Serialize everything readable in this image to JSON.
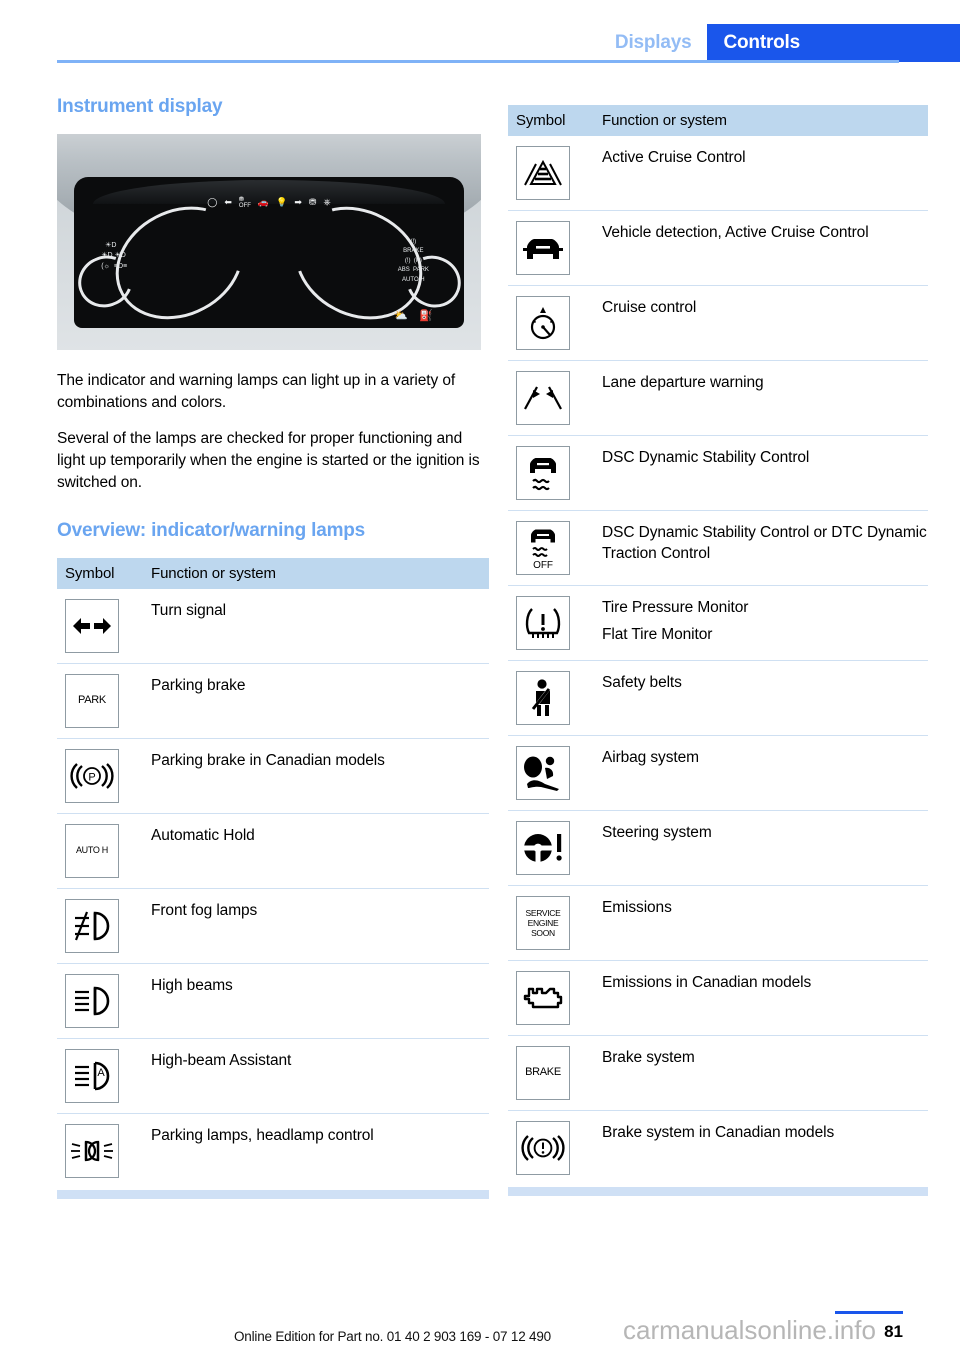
{
  "header": {
    "tab_inactive": "Displays",
    "tab_active": "Controls",
    "accent_blue": "#1A56EB",
    "light_blue": "#93bcf5"
  },
  "left": {
    "section_title": "Instrument display",
    "paragraphs": [
      "The indicator and warning lamps can light up in a variety of combinations and colors.",
      "Several of the lamps are checked for proper functioning and light up temporarily when the engine is started or the ignition is switched on."
    ],
    "overview_title": "Overview: indicator/warning lamps",
    "cluster": {
      "left_indicators": [
        "fog-lamp-icon",
        "low-beam-icon",
        "high-beam-icon",
        "parking-lamp-icon",
        "headlamp-icon"
      ],
      "right_indicators": [
        "BRAKE",
        "ABS",
        "PARK",
        "AUTO H"
      ],
      "bottom_right": "7\\  ☵"
    },
    "table": {
      "col_symbol": "Symbol",
      "col_function": "Function or system",
      "rows": [
        {
          "icon": "turn-signal-icon",
          "label": "Turn signal"
        },
        {
          "icon": "parking-brake-park-icon",
          "label": "Parking brake",
          "icon_text": "PARK"
        },
        {
          "icon": "parking-brake-p-icon",
          "label": "Parking brake in Canadian models"
        },
        {
          "icon": "automatic-hold-icon",
          "label": "Automatic Hold",
          "icon_text": "AUTO H"
        },
        {
          "icon": "front-fog-lamp-icon",
          "label": "Front fog lamps"
        },
        {
          "icon": "high-beam-icon",
          "label": "High beams"
        },
        {
          "icon": "high-beam-assistant-icon",
          "label": "High-beam Assistant"
        },
        {
          "icon": "parking-lamp-icon",
          "label": "Parking lamps, headlamp control"
        }
      ]
    }
  },
  "right": {
    "table": {
      "col_symbol": "Symbol",
      "col_function": "Function or system",
      "rows": [
        {
          "icon": "active-cruise-control-icon",
          "label": "Active Cruise Control"
        },
        {
          "icon": "vehicle-detection-icon",
          "label": "Vehicle detection, Active Cruise Control"
        },
        {
          "icon": "cruise-control-icon",
          "label": "Cruise control"
        },
        {
          "icon": "lane-departure-warning-icon",
          "label": "Lane departure warning"
        },
        {
          "icon": "dsc-icon",
          "label": "DSC Dynamic Stability Control"
        },
        {
          "icon": "dsc-off-icon",
          "label": "DSC Dynamic Stability Control or DTC Dynamic Traction Control",
          "icon_text": "OFF"
        },
        {
          "icon": "tire-pressure-monitor-icon",
          "label": "Tire Pressure Monitor",
          "label2": "Flat Tire Monitor"
        },
        {
          "icon": "safety-belt-icon",
          "label": "Safety belts"
        },
        {
          "icon": "airbag-icon",
          "label": "Airbag system"
        },
        {
          "icon": "steering-system-icon",
          "label": "Steering system"
        },
        {
          "icon": "service-engine-soon-icon",
          "label": "Emissions",
          "icon_text": "SERVICE ENGINE SOON"
        },
        {
          "icon": "check-engine-icon",
          "label": "Emissions in Canadian models"
        },
        {
          "icon": "brake-text-icon",
          "label": "Brake system",
          "icon_text": "BRAKE"
        },
        {
          "icon": "brake-circle-icon",
          "label": "Brake system in Canadian models"
        }
      ]
    }
  },
  "footer": {
    "edition_text": "Online Edition for Part no. 01 40 2 903 169 - 07 12 490",
    "page_number": "81",
    "watermark": "carmanualsonline.info"
  }
}
